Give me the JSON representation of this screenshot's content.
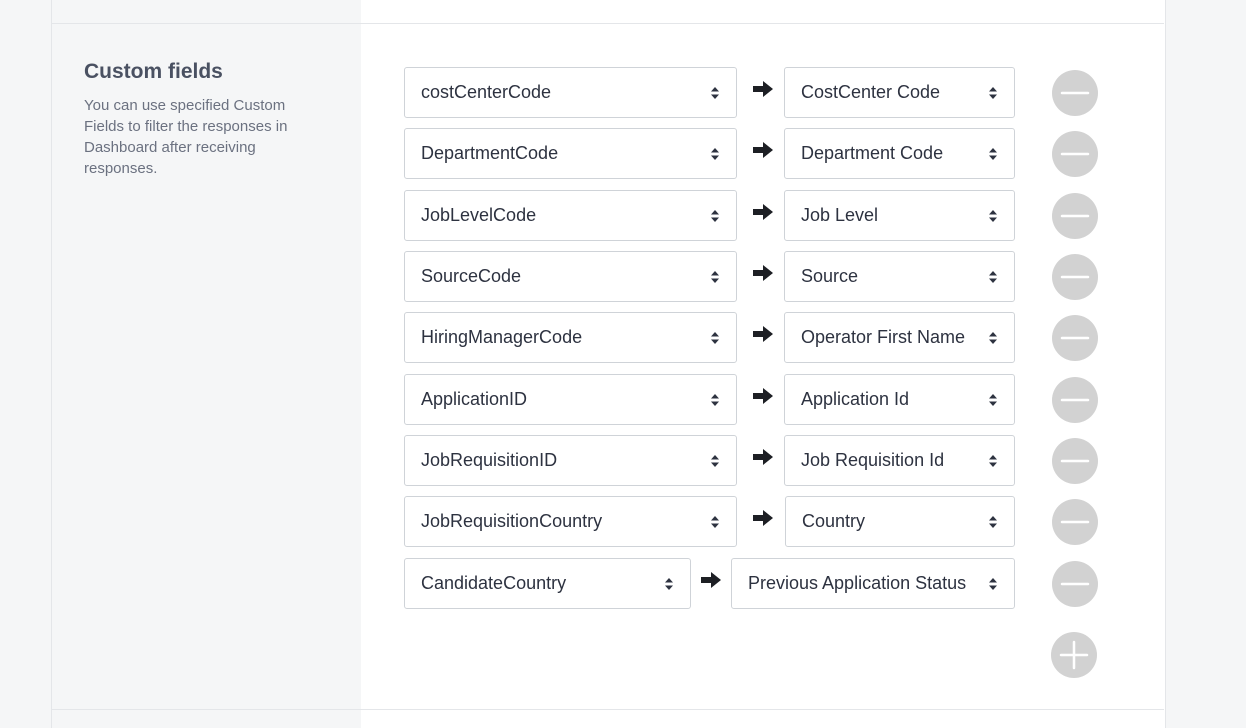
{
  "section": {
    "title": "Custom fields",
    "description": "You can use specified Custom Fields to filter the responses in Dashboard after receiving responses."
  },
  "mappings": [
    {
      "source": "costCenterCode",
      "target": "CostCenter Code"
    },
    {
      "source": "DepartmentCode",
      "target": "Department Code"
    },
    {
      "source": "JobLevelCode",
      "target": "Job Level"
    },
    {
      "source": "SourceCode",
      "target": "Source"
    },
    {
      "source": "HiringManagerCode",
      "target": "Operator First Name"
    },
    {
      "source": "ApplicationID",
      "target": "Application Id"
    },
    {
      "source": "JobRequisitionID",
      "target": "Job Requisition Id"
    },
    {
      "source": "JobRequisitionCountry",
      "target": "Country"
    },
    {
      "source": "CandidateCountry",
      "target": "Previous Application Status"
    }
  ],
  "icons": {
    "mapping_arrow": "arrow-right-icon",
    "select_caret": "sort-caret-icon",
    "remove": "minus-circle-icon",
    "add": "plus-circle-icon"
  },
  "colors": {
    "circle_button": "#d2d2d2",
    "text": "#2d3240",
    "muted_text": "#6b7180",
    "title": "#4a5162"
  }
}
